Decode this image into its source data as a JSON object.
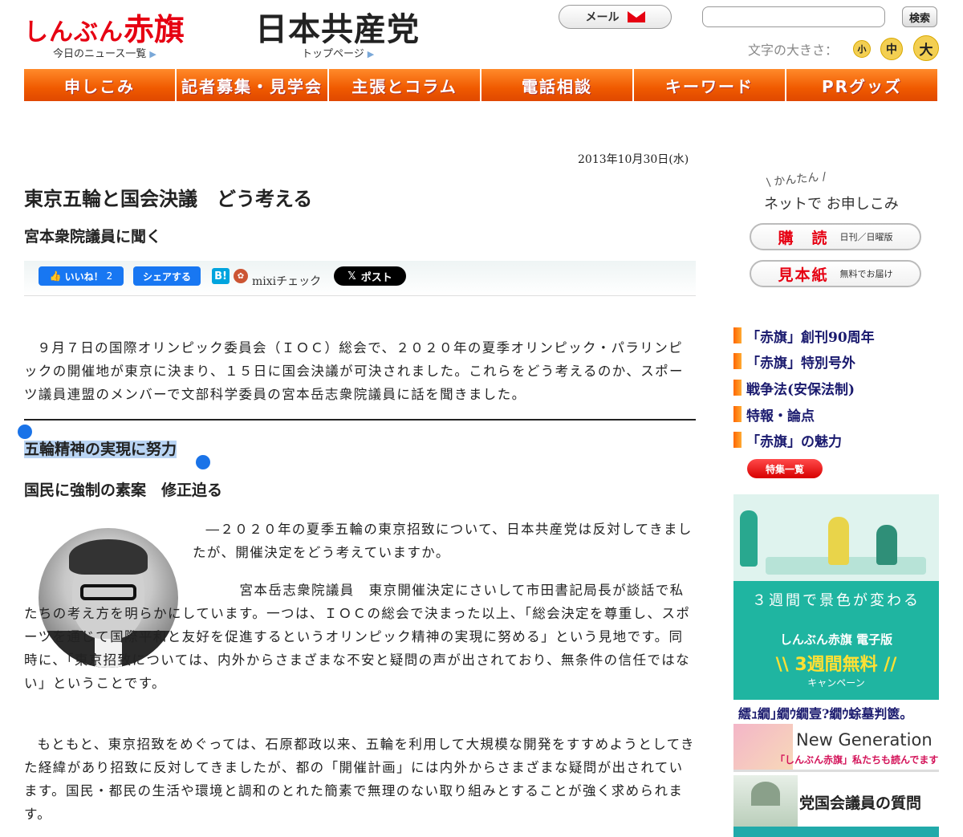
{
  "header": {
    "logo_kana": "しんぶん",
    "logo_kanji": "赤旗",
    "news_link": "今日のニュース一覧",
    "party_logo": "日本共産党",
    "top_link": "トップページ",
    "mail_label": "メール",
    "search_placeholder": "",
    "search_button": "検索",
    "font_size_label": "文字の大きさ：",
    "font_small": "小",
    "font_medium": "中",
    "font_large": "大"
  },
  "nav": {
    "items": [
      "申しこみ",
      "記者募集・見学会",
      "主張とコラム",
      "電話相談",
      "キーワード",
      "PRグッズ"
    ]
  },
  "article": {
    "date": "2013年10月30日(水)",
    "title": "東京五輪と国会決議　どう考える",
    "subtitle": "宮本衆院議員に聞く",
    "share": {
      "like": "いいね！",
      "like_count": "2",
      "share": "シェアする",
      "hatena": "B!",
      "mixi": "mixiチェック",
      "x_post": "ポスト"
    },
    "p1": "９月７日の国際オリンピック委員会（ＩＯＣ）総会で、２０２０年の夏季オリンピック・パラリンピックの開催地が東京に決まり、１５日に国会決議が可決されました。これらをどう考えるのか、スポーツ議員連盟のメンバーで文部科学委員の宮本岳志衆院議員に話を聞きました。",
    "heading2": "五輪精神の実現に努力",
    "heading3": "国民に強制の素案　修正迫る",
    "p2": "―２０２０年の夏季五輪の東京招致について、日本共産党は反対してきましたが、開催決定をどう考えていますか。",
    "p3": "　　　　　　　　　　　　　　　宮本岳志衆院議員　東京開催決定にさいして市田書記局長が談話で私たちの考え方を明らかにしています。一つは、ＩＯＣの総会で決まった以上、「総会決定を尊重し、スポーツを通じて国際平和と友好を促進するというオリンピック精神の実現に努める」という見地です。同時に、「東京招致については、内外からさまざまな不安と疑問の声が出されており、無条件の信任ではない」ということです。",
    "p4": "もともと、東京招致をめぐっては、石原都政以来、五輪を利用して大規模な開発をすすめようとしてきた経緯があり招致に反対してきましたが、都の「開催計画」には内外からさまざまな疑問が出されています。国民・都民の生活や環境と調和のとれた簡素で無理のない取り組みとすることが強く求められます。"
  },
  "sidebar": {
    "easy": "かんたん",
    "net_apply": "ネットで お申しこみ",
    "subscribe": "購　読",
    "subscribe_note": "日刊／日曜版",
    "sample": "見本紙",
    "sample_note": "無料でお届け",
    "features": [
      "「赤旗」創刊90周年",
      "「赤旗」特別号外",
      "戦争法(安保法制)",
      "特報・論点",
      "「赤旗」の魅力"
    ],
    "feature_list_button": "特集一覧",
    "banner": {
      "line1": "３週間で景色が変わる",
      "line2": "しんぶん赤旗 電子版",
      "line3": "\\\\ 3週間無料 //",
      "line4": "キャンペーン"
    },
    "garbled_text": "繧ｭ繝｣繝ｳ繝壹?繝ｳ蜍墓判篋。",
    "new_gen_title": "New Generation",
    "new_gen_sub": "「しんぶん赤旗」私たちも読んでます",
    "diet_title": "党国会議員の質問"
  },
  "colors": {
    "brand_red": "#e60012",
    "nav_orange": "#f05a00",
    "selection": "#b9d4f3",
    "banner_teal": "#1fb5a1"
  }
}
